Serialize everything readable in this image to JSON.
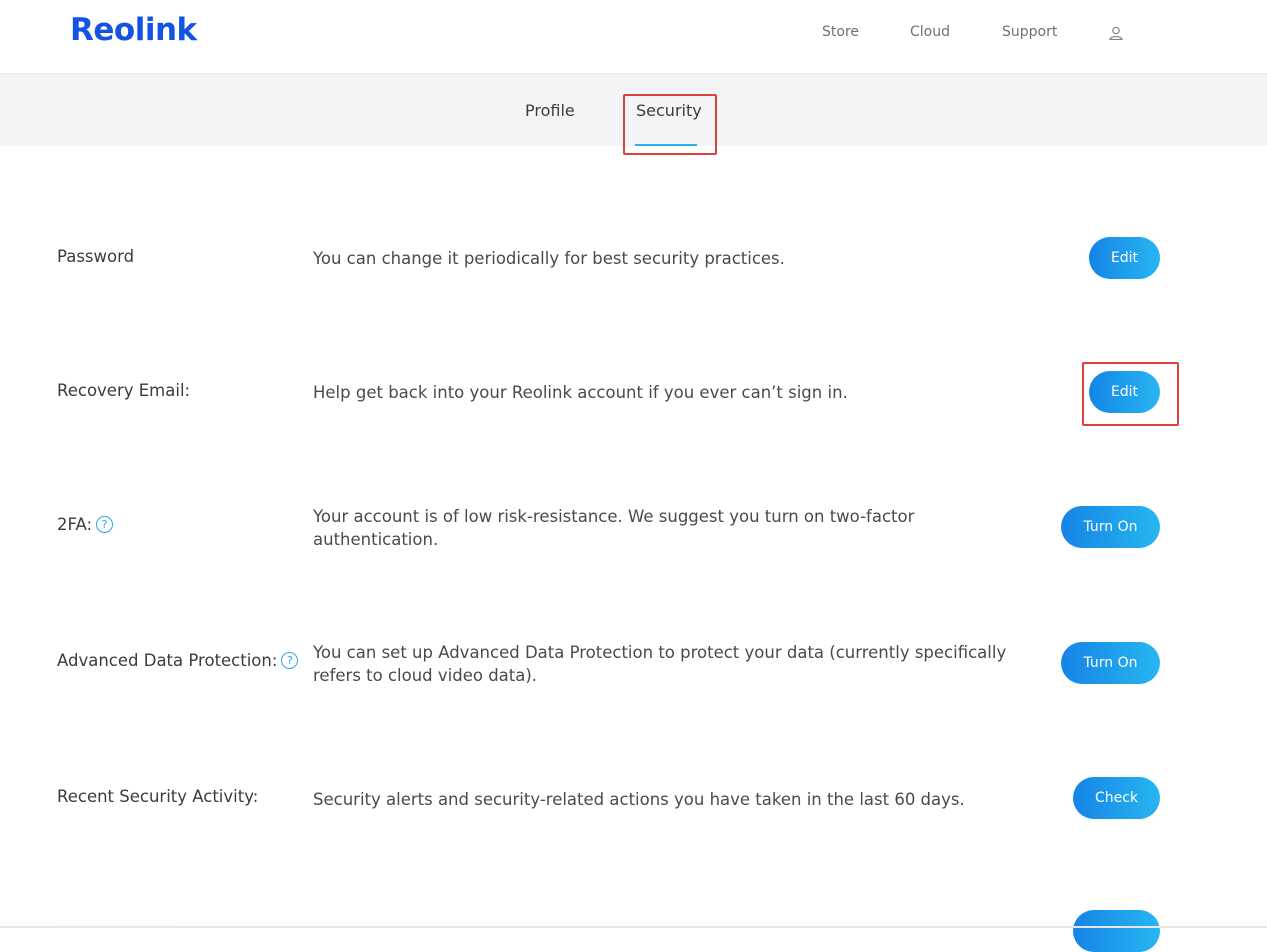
{
  "header": {
    "logo": "Reolink",
    "nav": [
      "Store",
      "Cloud",
      "Support"
    ]
  },
  "tabs": [
    "Profile",
    "Security"
  ],
  "rows": [
    {
      "label": "Password",
      "desc": "You can change it periodically for best security practices.",
      "button": "Edit"
    },
    {
      "label": "Recovery Email:",
      "desc": "Help get back into your Reolink account if you ever can’t sign in.",
      "button": "Edit"
    },
    {
      "label": "2FA:",
      "desc": "Your account is of low risk-resistance. We suggest you turn on two-factor authentication.",
      "button": "Turn On"
    },
    {
      "label": "Advanced Data Protection:",
      "desc": "You can set up Advanced Data Protection to protect your data (currently specifically refers to cloud video data).",
      "button": "Turn On"
    },
    {
      "label": "Recent Security Activity:",
      "desc": "Security alerts and security-related actions you have taken in the last 60 days.",
      "button": "Check"
    }
  ],
  "icons": {
    "help": "?"
  },
  "colors": {
    "brand": "#1354e5",
    "accent": "#2bb2ee",
    "highlight": "#e0403b"
  }
}
